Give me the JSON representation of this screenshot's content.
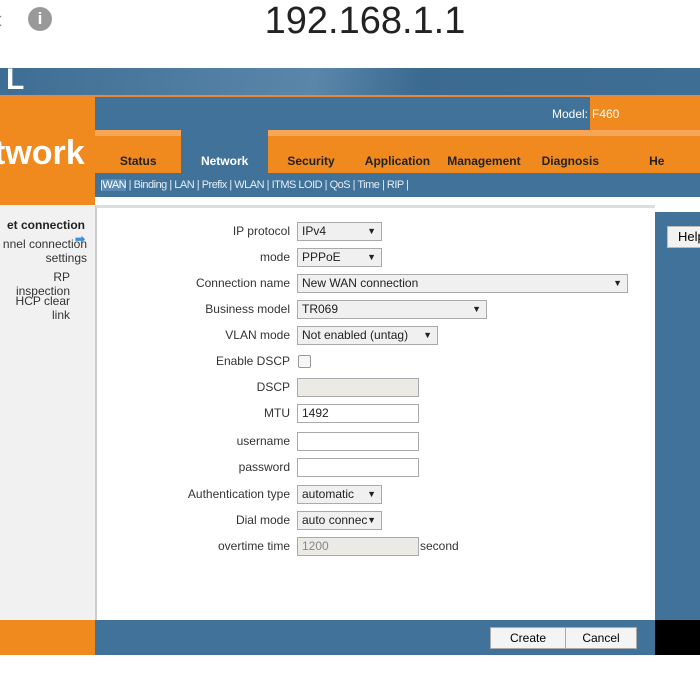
{
  "browser": {
    "url": "192.168.1.1",
    "back_icon": "chevron-left",
    "info_icon": "info-circle"
  },
  "header": {
    "logo": "L",
    "section_title": "twork",
    "model_label": "Model:",
    "model_value": "F460"
  },
  "tabs": [
    {
      "label": "Status"
    },
    {
      "label": "Network"
    },
    {
      "label": "Security"
    },
    {
      "label": "Application"
    },
    {
      "label": "Management"
    },
    {
      "label": "Diagnosis"
    },
    {
      "label": "He"
    }
  ],
  "submenu": [
    "WAN",
    "Binding",
    "LAN",
    "Prefix",
    "WLAN",
    "ITMS LOID",
    "QoS",
    "Time",
    "RIP"
  ],
  "sidebar": {
    "items": [
      "et connection",
      "nnel connection",
      "settings",
      "RP inspection",
      "HCP clear link"
    ]
  },
  "help_label": "Help",
  "form": {
    "ip_protocol": {
      "label": "IP protocol",
      "value": "IPv4"
    },
    "mode": {
      "label": "mode",
      "value": "PPPoE"
    },
    "connection_name": {
      "label": "Connection name",
      "value": "New WAN connection"
    },
    "business_model": {
      "label": "Business model",
      "value": "TR069"
    },
    "vlan_mode": {
      "label": "VLAN mode",
      "value": "Not enabled (untag)"
    },
    "enable_dscp": {
      "label": "Enable DSCP",
      "checked": false
    },
    "dscp": {
      "label": "DSCP",
      "value": ""
    },
    "mtu": {
      "label": "MTU",
      "value": "1492"
    },
    "username": {
      "label": "username",
      "value": ""
    },
    "password": {
      "label": "password",
      "value": ""
    },
    "auth_type": {
      "label": "Authentication type",
      "value": "automatic"
    },
    "dial_mode": {
      "label": "Dial mode",
      "value": "auto connec"
    },
    "overtime": {
      "label": "overtime time",
      "value": "1200",
      "unit": "second"
    }
  },
  "buttons": {
    "create": "Create",
    "cancel": "Cancel"
  }
}
